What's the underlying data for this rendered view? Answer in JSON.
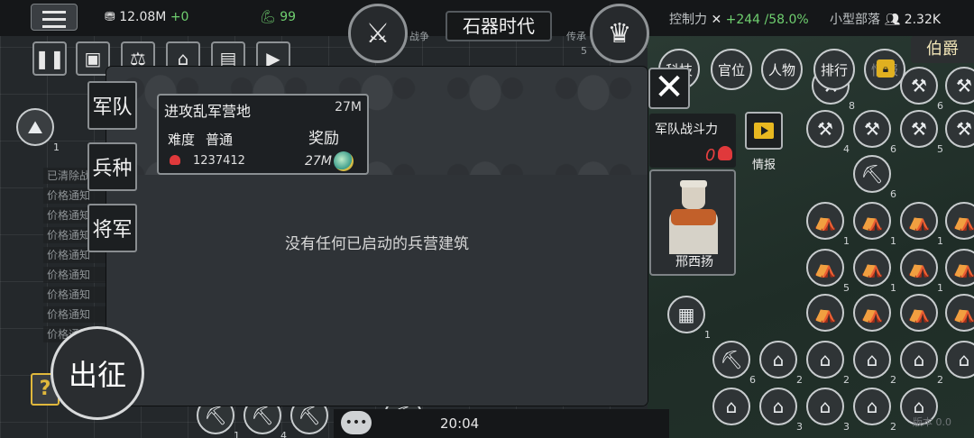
{
  "topbar": {
    "menu_icon": "hamburger-icon",
    "money": "12.08M",
    "money_delta": "+0",
    "strength": "99",
    "era": "石器时代",
    "war_label": "战争",
    "legacy_label": "传承",
    "legacy_count": "5",
    "control_label": "控制力",
    "control_value": "+244",
    "control_pct": "/58.0%",
    "tribe_label": "小型部落",
    "population": "2.32K",
    "rank": "伯爵"
  },
  "nav": {
    "tech": "科技",
    "office": "官位",
    "people": "人物",
    "ranking": "排行",
    "intel_locked": "情报",
    "tech_badge": "4",
    "people_badge": "8"
  },
  "log": {
    "items": [
      "已清除战",
      "价格通知",
      "价格通知",
      "价格通知",
      "价格通知",
      "价格通知",
      "价格通知",
      "价格通知",
      "价格通知"
    ]
  },
  "dialog": {
    "tabs": [
      "军队",
      "兵种",
      "将军"
    ],
    "mission": {
      "title": "进攻乱军营地",
      "reward_top": "27M",
      "difficulty_label": "难度",
      "difficulty_value": "普通",
      "reward_label": "奖励",
      "enemy_power": "1237412",
      "reward_value": "27M"
    },
    "empty_message": "没有任何已启动的兵营建筑",
    "close_icon": "close-icon"
  },
  "army": {
    "power_label": "军队战斗力",
    "power_value": "0",
    "info_label": "情报",
    "general_name": "邢西扬"
  },
  "bottom": {
    "march_label": "出征",
    "help_label": "?",
    "clock": "20:04",
    "corner": "版本 0.0"
  },
  "board": {
    "right_tiles_row1": [
      "8",
      "4",
      "6"
    ],
    "right_tiles_row2": [
      "4",
      "6",
      "5"
    ],
    "numbers": [
      "6",
      "1",
      "1",
      "1",
      "5",
      "1",
      "1",
      "6",
      "6",
      "2",
      "2",
      "2",
      "2",
      "2",
      "2",
      "3",
      "3",
      "2",
      "2",
      "1",
      "1",
      "1",
      "4",
      "2",
      "1",
      "6"
    ]
  }
}
